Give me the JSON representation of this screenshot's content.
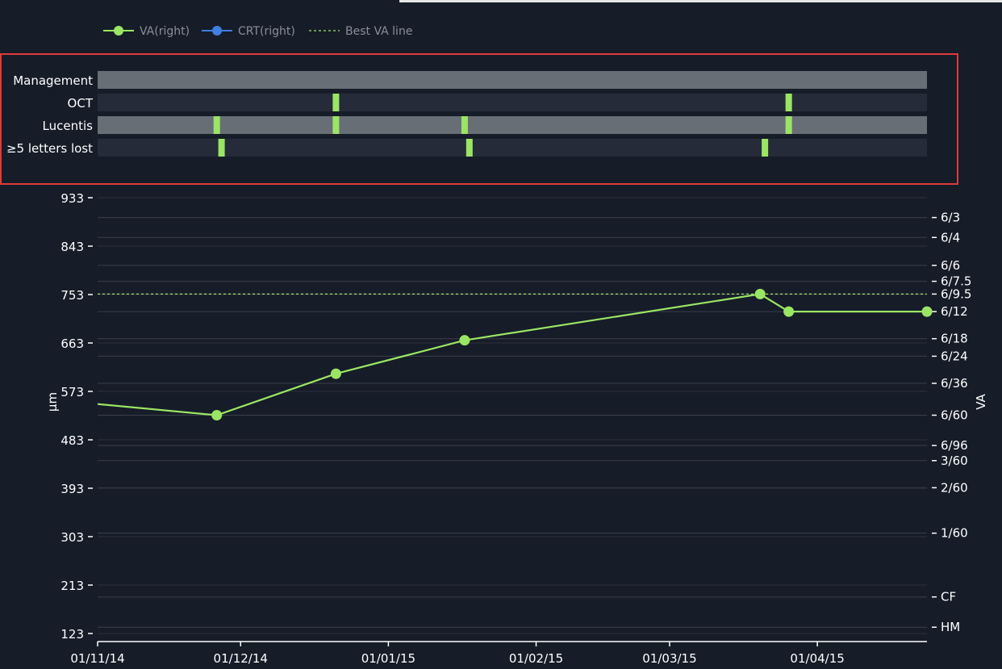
{
  "legend": [
    {
      "label": "VA(right)",
      "color": "#9be564",
      "style": "line-marker"
    },
    {
      "label": "CRT(right)",
      "color": "#3f7fe0",
      "style": "line-marker"
    },
    {
      "label": "Best VA line",
      "color": "#9be564",
      "style": "dashed"
    }
  ],
  "colors": {
    "background": "#161c28",
    "track_light": "#686e76",
    "track_dark": "#252b38",
    "event": "#9be564",
    "highlight_border": "#e03a3a",
    "grid": "#3a3f4a"
  },
  "chart_data": [
    {
      "type": "timeline",
      "rows": [
        {
          "label": "Management",
          "events": []
        },
        {
          "label": "OCT",
          "events": [
            "2014-12-21",
            "2015-03-26"
          ]
        },
        {
          "label": "Lucentis",
          "events": [
            "2014-11-26",
            "2014-12-21",
            "2015-01-17",
            "2015-03-26"
          ]
        },
        {
          "label": "≥5 letters lost",
          "events": [
            "2014-11-27",
            "2015-01-18",
            "2015-03-21"
          ]
        }
      ],
      "highlighted": true
    },
    {
      "type": "line",
      "x_type": "date",
      "xlim": [
        "2014-11-01",
        "2015-04-24"
      ],
      "x_ticks": [
        "01/11/14",
        "01/12/14",
        "01/01/15",
        "01/02/15",
        "01/03/15",
        "01/04/15"
      ],
      "x_tick_dates": [
        "2014-11-01",
        "2014-12-01",
        "2015-01-01",
        "2015-02-01",
        "2015-03-01",
        "2015-04-01"
      ],
      "ylabel": "µm",
      "y_ticks": [
        123,
        213,
        303,
        393,
        483,
        573,
        663,
        753,
        843,
        933
      ],
      "ylim": [
        108,
        948
      ],
      "y2label": "VA",
      "y2_ticks": [
        {
          "label": "6/3",
          "value": 4.0
        },
        {
          "label": "6/4",
          "value": 3.875
        },
        {
          "label": "6/6",
          "value": 3.7
        },
        {
          "label": "6/7.5",
          "value": 3.6
        },
        {
          "label": "6/9.5",
          "value": 3.52
        },
        {
          "label": "6/12",
          "value": 3.41
        },
        {
          "label": "6/18",
          "value": 3.24
        },
        {
          "label": "6/24",
          "value": 3.13
        },
        {
          "label": "6/36",
          "value": 2.96
        },
        {
          "label": "6/60",
          "value": 2.76
        },
        {
          "label": "6/96",
          "value": 2.57
        },
        {
          "label": "3/60",
          "value": 2.475
        },
        {
          "label": "2/60",
          "value": 2.305
        },
        {
          "label": "1/60",
          "value": 2.02
        },
        {
          "label": "CF",
          "value": 1.62
        },
        {
          "label": "HM",
          "value": 1.43
        }
      ],
      "y2lim": [
        1.34,
        4.175
      ],
      "best_va": 3.52,
      "series": [
        {
          "name": "VA(right)",
          "color": "#9be564",
          "points": [
            {
              "x": "2014-11-01",
              "y": 2.83,
              "marker": false
            },
            {
              "x": "2014-11-26",
              "y": 2.76,
              "marker": true
            },
            {
              "x": "2014-12-21",
              "y": 3.02,
              "marker": true
            },
            {
              "x": "2015-01-17",
              "y": 3.23,
              "marker": true
            },
            {
              "x": "2015-03-20",
              "y": 3.52,
              "marker": true
            },
            {
              "x": "2015-03-26",
              "y": 3.41,
              "marker": true
            },
            {
              "x": "2015-04-24",
              "y": 3.41,
              "marker": true
            }
          ]
        }
      ],
      "grid": true,
      "legend_position": "top-left"
    }
  ]
}
